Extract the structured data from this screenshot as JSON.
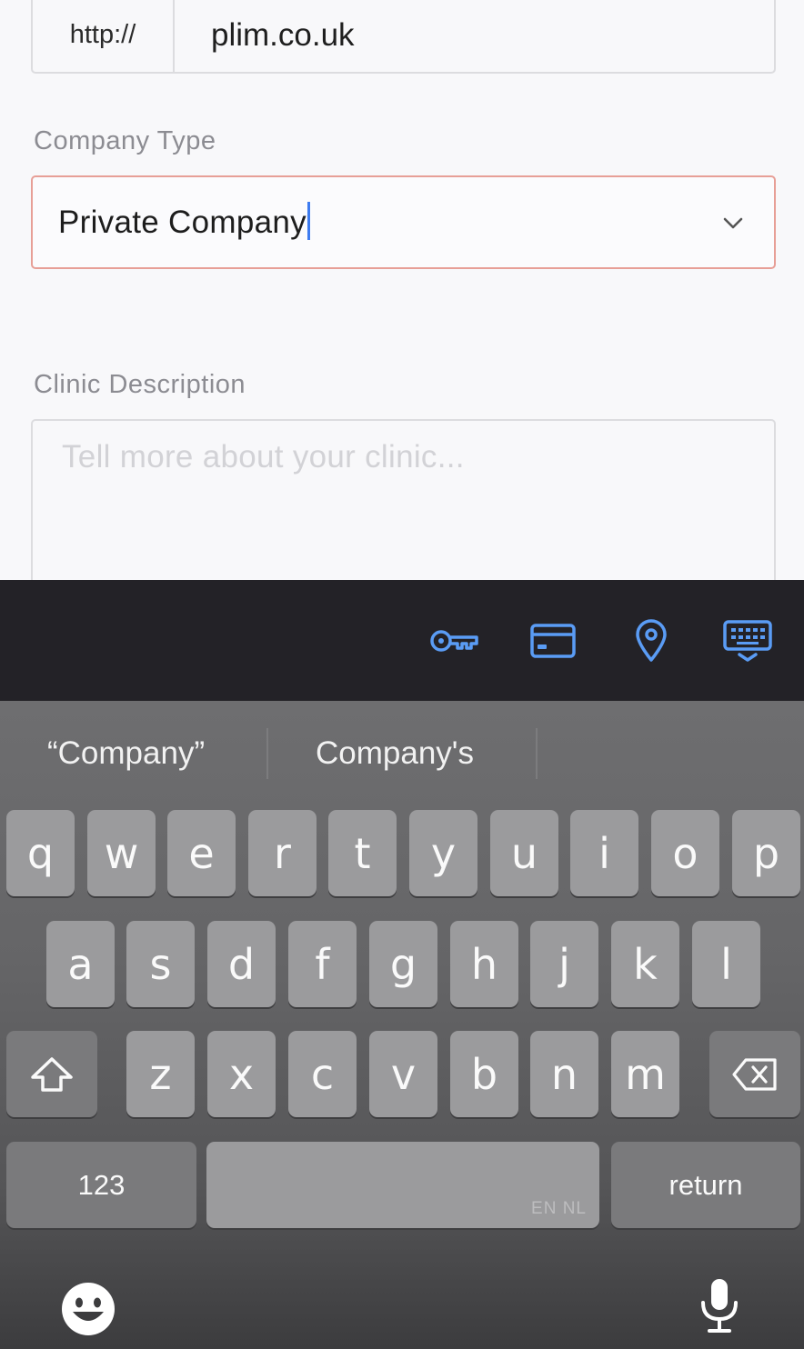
{
  "form": {
    "website": {
      "prefix": "http://",
      "value": "plim.co.uk"
    },
    "company_type": {
      "label": "Company Type",
      "value": "Private Company"
    },
    "clinic_description": {
      "label": "Clinic Description",
      "placeholder": "Tell more about your clinic..."
    }
  },
  "accessory_bar": {
    "icons": [
      "key-icon",
      "credit-card-icon",
      "location-pin-icon",
      "keyboard-hide-icon"
    ],
    "icon_color": "#5a9cf5"
  },
  "keyboard": {
    "suggestions": [
      "“Company”",
      "Company's"
    ],
    "row1": [
      "q",
      "w",
      "e",
      "r",
      "t",
      "y",
      "u",
      "i",
      "o",
      "p"
    ],
    "row2": [
      "a",
      "s",
      "d",
      "f",
      "g",
      "h",
      "j",
      "k",
      "l"
    ],
    "row3": [
      "z",
      "x",
      "c",
      "v",
      "b",
      "n",
      "m"
    ],
    "numbers_key": "123",
    "return_key": "return",
    "space_languages": "EN NL",
    "shift_icon": "shift-icon",
    "delete_icon": "delete-icon",
    "emoji_icon": "emoji-icon",
    "mic_icon": "microphone-icon"
  }
}
